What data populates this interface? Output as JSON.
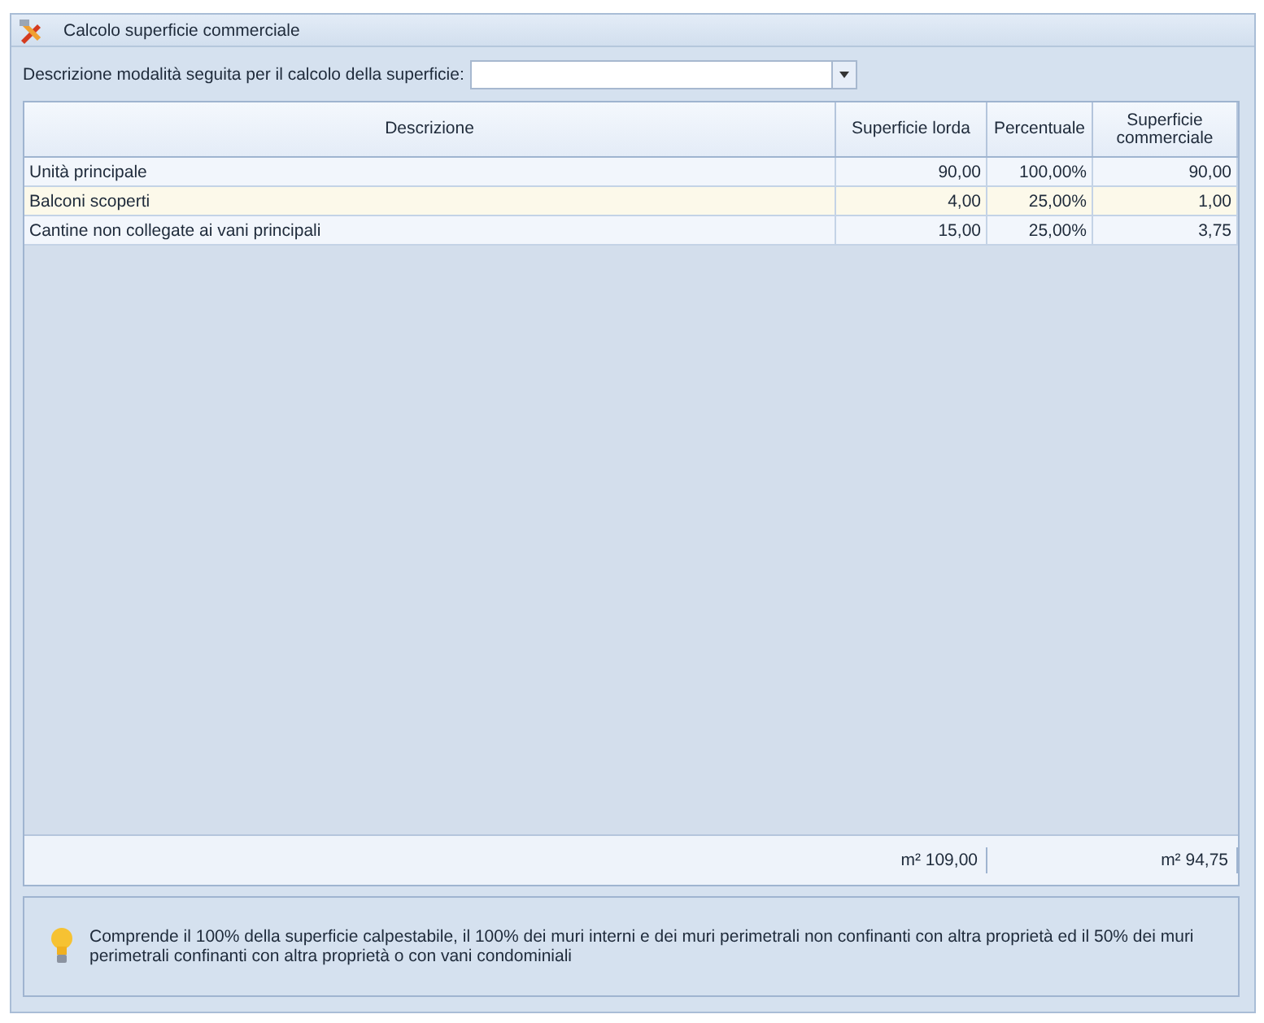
{
  "window": {
    "title": "Calcolo superficie commerciale"
  },
  "mode_field": {
    "label": "Descrizione modalità seguita per il calcolo della superficie:"
  },
  "table": {
    "columns": [
      "Descrizione",
      "Superficie lorda",
      "Percentuale",
      "Superficie commerciale"
    ],
    "rows": [
      {
        "cells": [
          "Unità principale",
          "90,00",
          "100,00%",
          "90,00"
        ],
        "selected": false
      },
      {
        "cells": [
          "Balconi scoperti",
          "4,00",
          "25,00%",
          "1,00"
        ],
        "selected": true
      },
      {
        "cells": [
          "Cantine non collegate ai vani principali",
          "15,00",
          "25,00%",
          "3,75"
        ],
        "selected": false
      }
    ],
    "totals": {
      "gross_area": "m² 109,00",
      "commercial_area": "m² 94,75"
    }
  },
  "info": {
    "text": "Comprende il 100% della superficie calpestabile, il 100% dei muri interni e dei muri perimetrali non confinanti con altra proprietà ed il 50% dei muri perimetrali confinanti con altra proprietà o con vani condominiali"
  }
}
